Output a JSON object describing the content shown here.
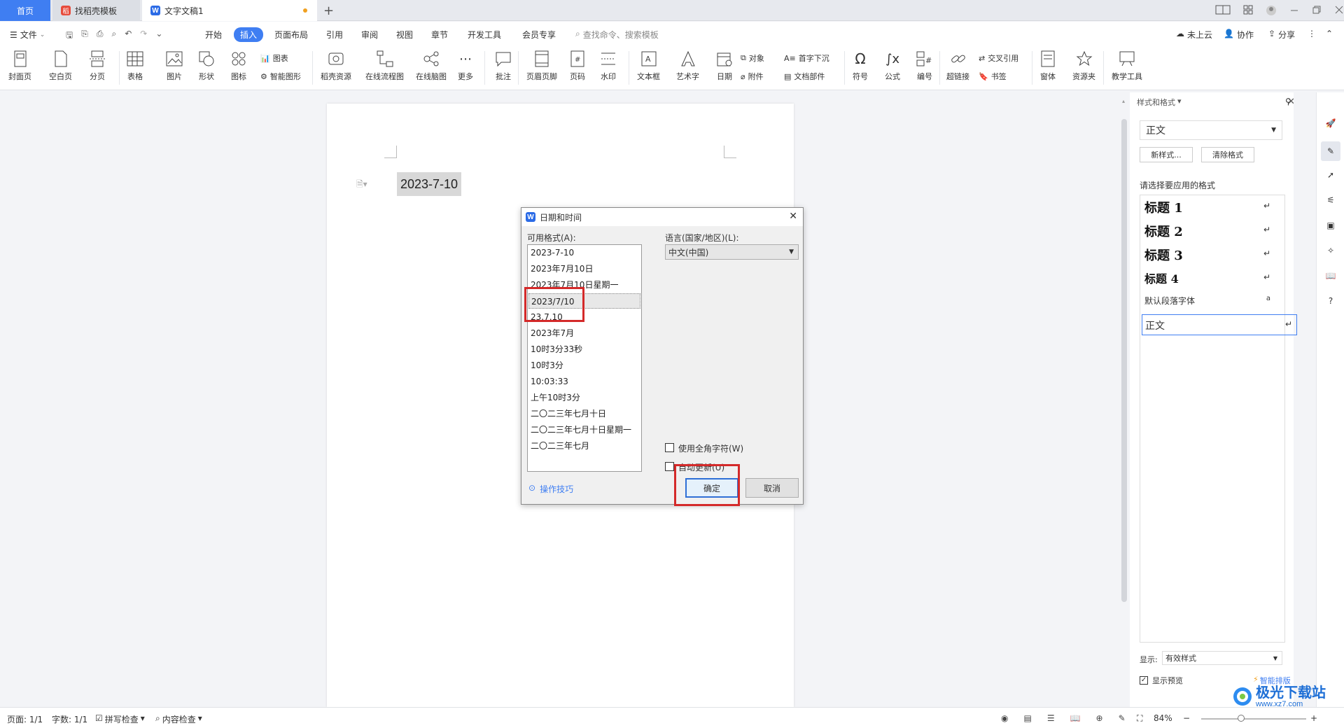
{
  "tabs": {
    "home": "首页",
    "template": "找稻壳模板",
    "document": "文字文稿1",
    "new_tab": "+"
  },
  "menu": {
    "file": "文件",
    "items": [
      "开始",
      "插入",
      "页面布局",
      "引用",
      "审阅",
      "视图",
      "章节",
      "开发工具",
      "会员专享"
    ],
    "active": "插入",
    "search_placeholder": "查找命令、搜索模板",
    "cloud": "未上云",
    "collab": "协作",
    "share": "分享"
  },
  "ribbon": {
    "cover": "封面页",
    "blank": "空白页",
    "pagebreak": "分页",
    "table": "表格",
    "picture": "图片",
    "shape": "形状",
    "icon": "图标",
    "chart": "图表",
    "smartart": "智能图形",
    "resource": "稻壳资源",
    "flowchart": "在线流程图",
    "mindmap": "在线脑图",
    "more": "更多",
    "comment": "批注",
    "header_footer": "页眉页脚",
    "page_number": "页码",
    "watermark": "水印",
    "textbox": "文本框",
    "wordart": "艺术字",
    "date": "日期",
    "object": "对象",
    "attachment": "附件",
    "dropcap": "首字下沉",
    "docpart": "文档部件",
    "symbol": "符号",
    "formula": "公式",
    "numbering": "编号",
    "hyperlink": "超链接",
    "crossref": "交叉引用",
    "bookmark": "书签",
    "window": "窗体",
    "resources": "资源夹",
    "teaching": "教学工具"
  },
  "document": {
    "date_text": "2023-7-10"
  },
  "dialog": {
    "title": "日期和时间",
    "formats_label": "可用格式(A):",
    "formats": [
      "2023-7-10",
      "2023年7月10日",
      "2023年7月10日星期一",
      "2023/7/10",
      "23.7.10",
      "2023年7月",
      "10时3分33秒",
      "10时3分",
      "10:03:33",
      "上午10时3分",
      "二〇二三年七月十日",
      "二〇二三年七月十日星期一",
      "二〇二三年七月"
    ],
    "selected_index": 3,
    "language_label": "语言(国家/地区)(L):",
    "language_value": "中文(中国)",
    "fullwidth_label": "使用全角字符(W)",
    "autoupdate_label": "自动更新(U)",
    "tips": "操作技巧",
    "ok": "确定",
    "cancel": "取消"
  },
  "style_panel": {
    "title": "样式和格式",
    "current": "正文",
    "new_style": "新样式...",
    "clear_format": "清除格式",
    "prompt": "请选择要应用的格式",
    "styles": [
      "标题 1",
      "标题 2",
      "标题 3",
      "标题 4"
    ],
    "default_font": "默认段落字体",
    "body": "正文",
    "show_label": "显示:",
    "show_value": "有效样式",
    "preview_label": "显示预览",
    "smart_layout": "智能排版"
  },
  "status": {
    "page": "页面: 1/1",
    "words": "字数: 1/1",
    "spell": "拼写检查",
    "content": "内容检查",
    "zoom": "84%"
  },
  "watermark_text": "极光下载站",
  "watermark_url": "www.xz7.com",
  "colors": {
    "accent": "#3f7ef2",
    "highlight_red": "#d42a2a"
  }
}
